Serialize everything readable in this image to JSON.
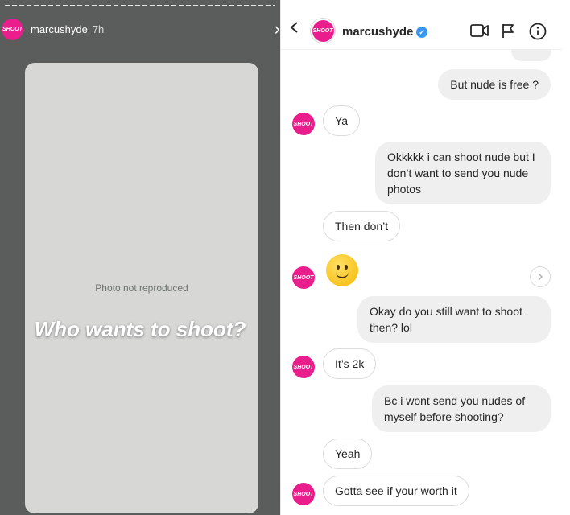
{
  "story": {
    "username": "marcushyde",
    "time": "7h",
    "avatar_text": "SHOOT",
    "caption": "Who wants to shoot?",
    "photo_note": "Photo not reproduced"
  },
  "dm": {
    "header": {
      "username": "marcushyde",
      "avatar_text": "SHOOT",
      "verified": true,
      "icons": [
        "back-icon",
        "video-call-icon",
        "flag-icon",
        "info-icon"
      ]
    },
    "messages": [
      {
        "side": "out",
        "text": "But nude is free ?"
      },
      {
        "side": "in",
        "text": "Ya"
      },
      {
        "side": "out",
        "text": "Okkkkk i can shoot nude but I don’t want to send you nude photos"
      },
      {
        "side": "in",
        "text": "Then don’t"
      },
      {
        "side": "in",
        "type": "emoji",
        "emoji": "slightly-smiling-face"
      },
      {
        "side": "out",
        "text": "Okay do you still want to shoot then? lol"
      },
      {
        "side": "in",
        "text": "It’s 2k"
      },
      {
        "side": "out",
        "text": "Bc i wont send you nudes of myself before shooting?"
      },
      {
        "side": "in",
        "text": "Yeah"
      },
      {
        "side": "in",
        "text": "Gotta see if your worth it"
      }
    ]
  },
  "colors": {
    "brand": "#e91e8c",
    "verified": "#3897f0",
    "outgoing_bubble": "#efefef",
    "incoming_border": "#dbdbdb"
  }
}
